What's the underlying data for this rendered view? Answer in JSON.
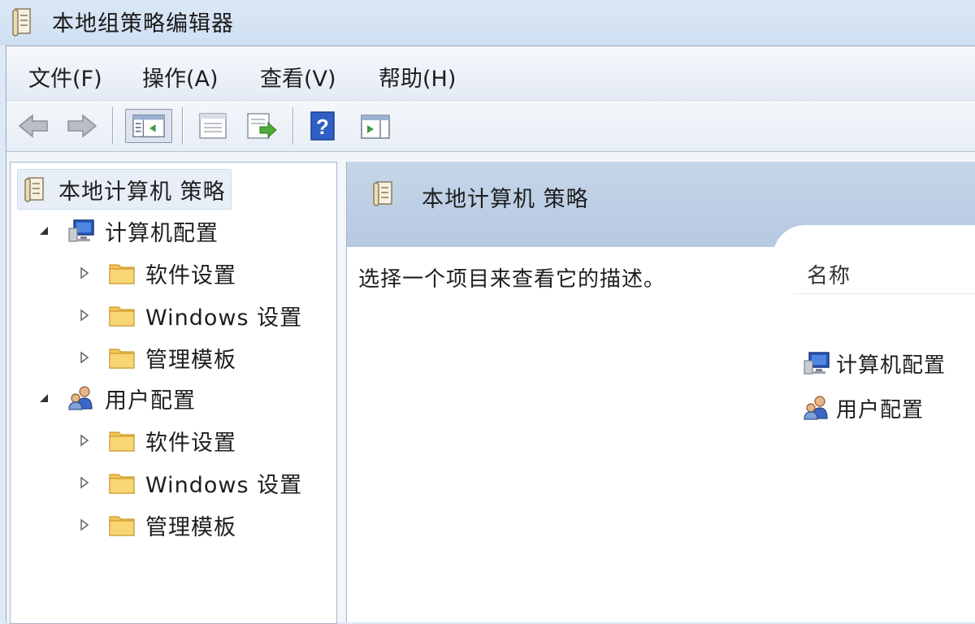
{
  "window": {
    "title": "本地组策略编辑器"
  },
  "menu": [
    "文件(F)",
    "操作(A)",
    "查看(V)",
    "帮助(H)"
  ],
  "toolbar": {
    "buttons": [
      "back-icon",
      "forward-icon",
      "show-hide-tree-icon",
      "properties-icon",
      "export-list-icon",
      "help-icon",
      "show-hide-action-pane-icon"
    ]
  },
  "tree": {
    "root": {
      "label": "本地计算机 策略",
      "icon": "policy-scroll-icon"
    },
    "nodes": [
      {
        "label": "计算机配置",
        "icon": "computer-icon",
        "expanded": true,
        "children": [
          {
            "label": "软件设置",
            "icon": "folder-icon"
          },
          {
            "label": "Windows 设置",
            "icon": "folder-icon"
          },
          {
            "label": "管理模板",
            "icon": "folder-icon"
          }
        ]
      },
      {
        "label": "用户配置",
        "icon": "users-icon",
        "expanded": true,
        "children": [
          {
            "label": "软件设置",
            "icon": "folder-icon"
          },
          {
            "label": "Windows 设置",
            "icon": "folder-icon"
          },
          {
            "label": "管理模板",
            "icon": "folder-icon"
          }
        ]
      }
    ]
  },
  "details": {
    "title": "本地计算机 策略",
    "description": "选择一个项目来查看它的描述。",
    "column_header": "名称",
    "items": [
      {
        "label": "计算机配置",
        "icon": "computer-icon"
      },
      {
        "label": "用户配置",
        "icon": "users-icon"
      }
    ]
  },
  "colors": {
    "title_bar": "#dbe7f6",
    "header_band": "#c0d2e8",
    "selection": "#e7eef8",
    "folder": "#f4c552"
  }
}
